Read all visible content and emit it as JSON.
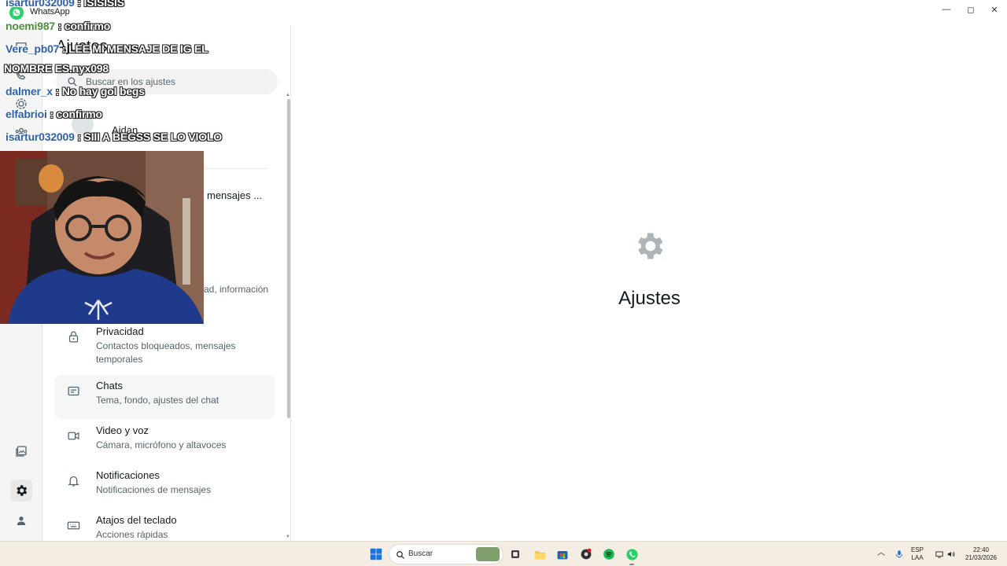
{
  "window": {
    "app_title": "WhatsApp",
    "minimize_symbol": "—",
    "maximize_symbol": "◻",
    "close_symbol": "✕"
  },
  "rail": {
    "icons": [
      "chats-icon",
      "calls-icon",
      "status-icon",
      "communities-icon",
      "media-icon",
      "settings-icon",
      "profile-icon"
    ]
  },
  "settings": {
    "title": "Ajustes",
    "search_placeholder": "Buscar en los ajustes",
    "profile_name": "Aidan",
    "partial_1": "mensajes ...",
    "partial_2": "ad, información",
    "items": [
      {
        "label": "Privacidad",
        "desc": "Contactos bloqueados, mensajes temporales",
        "icon": "lock-icon"
      },
      {
        "label": "Chats",
        "desc": "Tema, fondo, ajustes del chat",
        "icon": "chat-icon"
      },
      {
        "label": "Video y voz",
        "desc": "Cámara, micrófono y altavoces",
        "icon": "video-icon"
      },
      {
        "label": "Notificaciones",
        "desc": "Notificaciones de mensajes",
        "icon": "bell-icon"
      },
      {
        "label": "Atajos del teclado",
        "desc": "Acciones rápidas",
        "icon": "keyboard-icon"
      }
    ]
  },
  "main": {
    "title": "Ajustes",
    "icon": "gear-icon"
  },
  "chat_overlay": {
    "messages": [
      {
        "user": "isartur032009",
        "msg": ": ISISISIS"
      },
      {
        "user": "noemi987",
        "msg": ": confirmo"
      },
      {
        "user": "Vere_pb07",
        "msg": ": LEE MI MENSAJE DE IG EL"
      },
      {
        "user": "",
        "msg": "NOMBRE ES.nyx098"
      },
      {
        "user": "dalmer_x",
        "msg": ": No hay gol begs"
      },
      {
        "user": "elfabrioi",
        "msg": ": confirmo"
      },
      {
        "user": "isartur032009",
        "msg": ": SIII A BEGSS SE LO VIOLO"
      }
    ]
  },
  "taskbar": {
    "search_label": "Buscar",
    "lang_top": "ESP",
    "lang_bottom": "LAA",
    "time": "22:40",
    "date": "21/03/2026"
  },
  "colors": {
    "whatsapp_green": "#25d366",
    "text_primary": "#111b21",
    "text_secondary": "#54656f",
    "taskbar_bg": "#f3ede4"
  }
}
